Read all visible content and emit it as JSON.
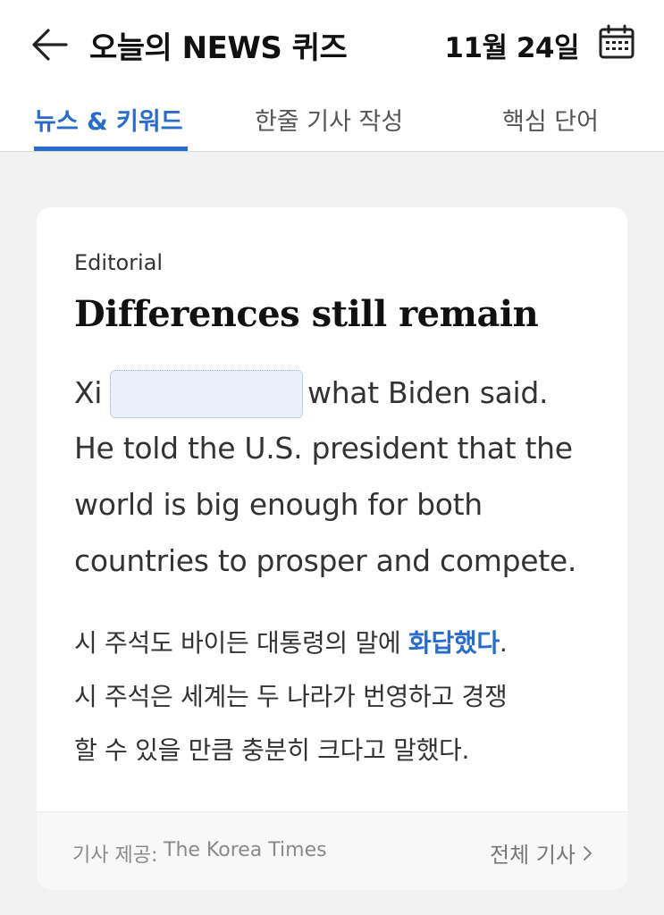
{
  "header": {
    "title": "오늘의 NEWS 퀴즈",
    "date": "11월 24일",
    "back_icon": "arrow-left-icon",
    "calendar_icon": "calendar-icon"
  },
  "tabs": [
    {
      "label": "뉴스 & 키워드",
      "active": true
    },
    {
      "label": "한줄 기사 작성",
      "active": false
    },
    {
      "label": "핵심 단어",
      "active": false
    }
  ],
  "card": {
    "category": "Editorial",
    "headline": "Differences still remain",
    "english": {
      "line1_prefix": "Xi",
      "line1_suffix": "what Biden said.",
      "line2": "He told the U.S. president that the",
      "line3": "world is big enough for both",
      "line4": "countries to prosper and compete.",
      "blank_value": ""
    },
    "korean": {
      "line1_before": "시 주석도 바이든 대통령의 말에 ",
      "line1_highlight": "화답했다",
      "line1_after": ".",
      "line2": "시 주석은 세계는 두 나라가 번영하고 경쟁",
      "line3": "할 수 있을 만큼 충분히 크다고 말했다."
    },
    "footer": {
      "source_label": "기사 제공:",
      "source_name": "The Korea Times",
      "full_article_label": "전체 기사",
      "chevron_icon": "chevron-right-icon"
    }
  },
  "colors": {
    "accent": "#2a6cc9",
    "background": "#f2f2f2",
    "blank_fill": "#e9f0fb"
  }
}
